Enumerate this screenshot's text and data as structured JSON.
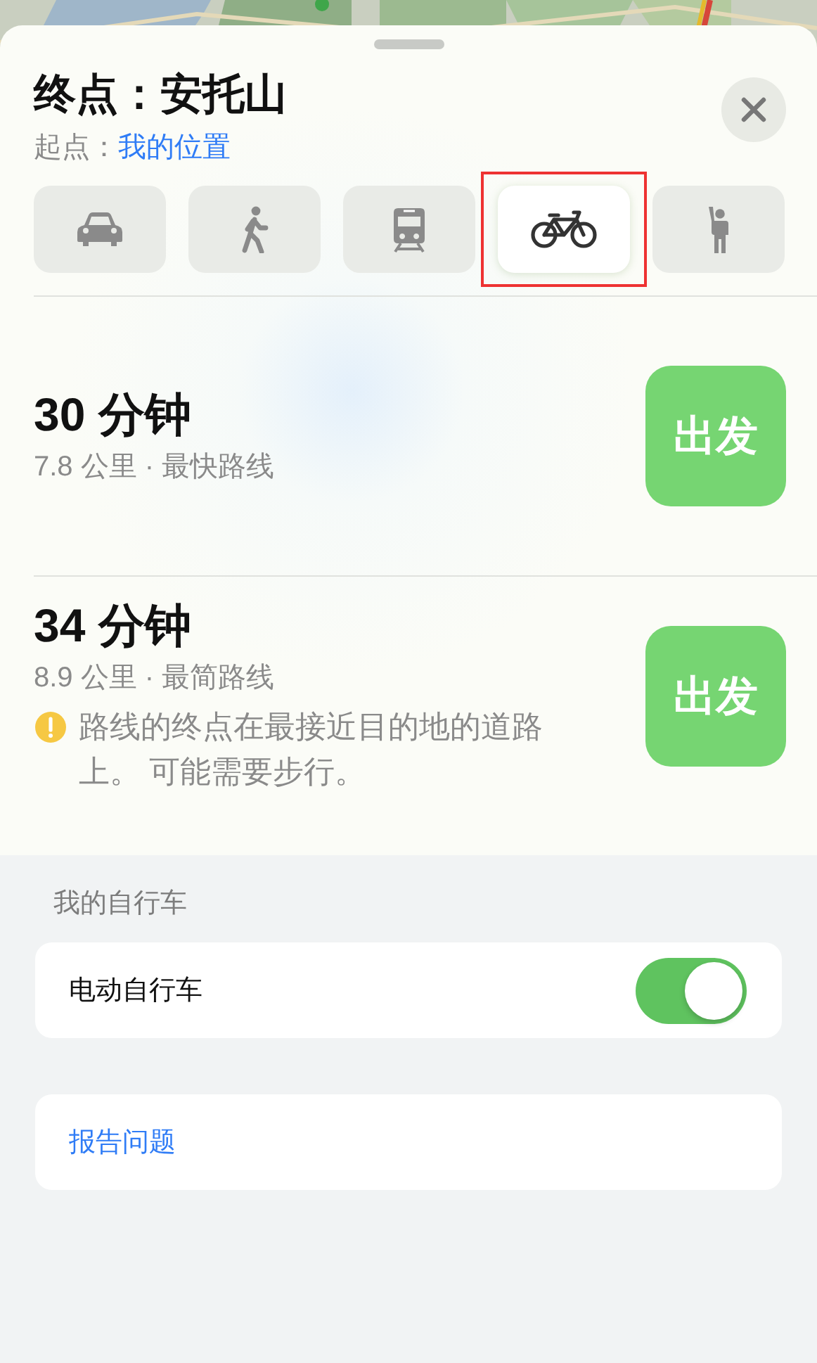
{
  "header": {
    "title": "终点：安托山",
    "origin_label": "起点：",
    "origin": "我的位置"
  },
  "modes": [
    {
      "kind": "car",
      "selected": false,
      "highlighted": false
    },
    {
      "kind": "walk",
      "selected": false,
      "highlighted": false
    },
    {
      "kind": "transit",
      "selected": false,
      "highlighted": false
    },
    {
      "kind": "cycle",
      "selected": true,
      "highlighted": true
    },
    {
      "kind": "rideshare",
      "selected": false,
      "highlighted": false
    }
  ],
  "routes": [
    {
      "duration": "30 分钟",
      "details": "7.8 公里 · 最快路线",
      "go": "出发"
    },
    {
      "duration": "34 分钟",
      "details": "8.9 公里 · 最简路线",
      "warning": "路线的终点在最接近目的地的道路上。 可能需要步行。",
      "go": "出发"
    }
  ],
  "my_bike": {
    "heading": "我的自行车",
    "options": [
      {
        "label": "电动自行车",
        "on": true
      }
    ]
  },
  "report": "报告问题"
}
